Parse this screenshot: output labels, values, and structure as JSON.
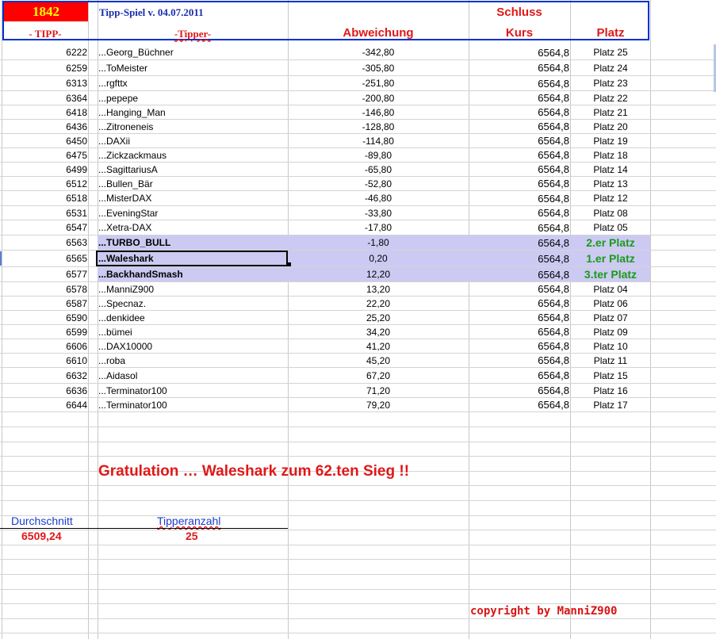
{
  "header": {
    "number": "1842",
    "title": "Tipp-Spiel v. 04.07.2011",
    "schluss": "Schluss",
    "col_tipp": "- TIPP-",
    "col_tipper": "-Tipper-",
    "col_abweichung": "Abweichung",
    "col_kurs": "Kurs",
    "col_platz": "Platz"
  },
  "rows": [
    {
      "tipp": "6222",
      "name": "...Georg_Büchner",
      "abw": "-342,80",
      "kurs": "6564,8",
      "platz": "Platz 25"
    },
    {
      "tipp": "6259",
      "name": "...ToMeister",
      "abw": "-305,80",
      "kurs": "6564,8",
      "platz": "Platz 24"
    },
    {
      "tipp": "6313",
      "name": "...rgfttx",
      "abw": "-251,80",
      "kurs": "6564,8",
      "platz": "Platz 23"
    },
    {
      "tipp": "6364",
      "name": "...pepepe",
      "abw": "-200,80",
      "kurs": "6564,8",
      "platz": "Platz 22"
    },
    {
      "tipp": "6418",
      "name": "...Hanging_Man",
      "abw": "-146,80",
      "kurs": "6564,8",
      "platz": "Platz 21"
    },
    {
      "tipp": "6436",
      "name": "...Zitroneneis",
      "abw": "-128,80",
      "kurs": "6564,8",
      "platz": "Platz 20"
    },
    {
      "tipp": "6450",
      "name": "...DAXii",
      "abw": "-114,80",
      "kurs": "6564,8",
      "platz": "Platz 19"
    },
    {
      "tipp": "6475",
      "name": "...Zickzackmaus",
      "abw": "-89,80",
      "kurs": "6564,8",
      "platz": "Platz 18"
    },
    {
      "tipp": "6499",
      "name": "...SagittariusA",
      "abw": "-65,80",
      "kurs": "6564,8",
      "platz": "Platz 14"
    },
    {
      "tipp": "6512",
      "name": "...Bullen_Bär",
      "abw": "-52,80",
      "kurs": "6564,8",
      "platz": "Platz 13"
    },
    {
      "tipp": "6518",
      "name": "...MisterDAX",
      "abw": "-46,80",
      "kurs": "6564,8",
      "platz": "Platz 12"
    },
    {
      "tipp": "6531",
      "name": "...EveningStar",
      "abw": "-33,80",
      "kurs": "6564,8",
      "platz": "Platz 08"
    },
    {
      "tipp": "6547",
      "name": "...Xetra-DAX",
      "abw": "-17,80",
      "kurs": "6564,8",
      "platz": "Platz 05"
    },
    {
      "tipp": "6563",
      "name": "...TURBO_BULL",
      "abw": "-1,80",
      "kurs": "6564,8",
      "platz": "2.er Platz"
    },
    {
      "tipp": "6565",
      "name": "...Waleshark",
      "abw": "0,20",
      "kurs": "6564,8",
      "platz": "1.er Platz"
    },
    {
      "tipp": "6577",
      "name": "...BackhandSmash",
      "abw": "12,20",
      "kurs": "6564,8",
      "platz": "3.ter Platz"
    },
    {
      "tipp": "6578",
      "name": "...ManniZ900",
      "abw": "13,20",
      "kurs": "6564,8",
      "platz": "Platz 04"
    },
    {
      "tipp": "6587",
      "name": "...Specnaz.",
      "abw": "22,20",
      "kurs": "6564,8",
      "platz": "Platz 06"
    },
    {
      "tipp": "6590",
      "name": "...denkidee",
      "abw": "25,20",
      "kurs": "6564,8",
      "platz": "Platz 07"
    },
    {
      "tipp": "6599",
      "name": "...bümei",
      "abw": "34,20",
      "kurs": "6564,8",
      "platz": "Platz 09"
    },
    {
      "tipp": "6606",
      "name": "...DAX10000",
      "abw": "41,20",
      "kurs": "6564,8",
      "platz": "Platz 10"
    },
    {
      "tipp": "6610",
      "name": "...roba",
      "abw": "45,20",
      "kurs": "6564,8",
      "platz": "Platz 11"
    },
    {
      "tipp": "6632",
      "name": "...Aidasol",
      "abw": "67,20",
      "kurs": "6564,8",
      "platz": "Platz 15"
    },
    {
      "tipp": "6636",
      "name": "...Terminator100",
      "abw": "71,20",
      "kurs": "6564,8",
      "platz": "Platz 16"
    },
    {
      "tipp": "6644",
      "name": "...Terminator100",
      "abw": "79,20",
      "kurs": "6564,8",
      "platz": "Platz 17"
    }
  ],
  "congrats": "Gratulation  … Waleshark  zum   62.ten Sieg !!",
  "summary": {
    "durchschnitt_label": "Durchschnitt",
    "durchschnitt_value": "6509,24",
    "tipperanzahl_label": "Tipperanzahl",
    "tipperanzahl_value": "25"
  },
  "copyright": "copyright by ManniZ900",
  "colors": {
    "frame": "#0033cc",
    "number_bg": "#ff0000",
    "number_text": "#ffff00",
    "header_red": "#e01818",
    "highlight": "#cccaf2",
    "winner_green": "#1a9a1a"
  }
}
